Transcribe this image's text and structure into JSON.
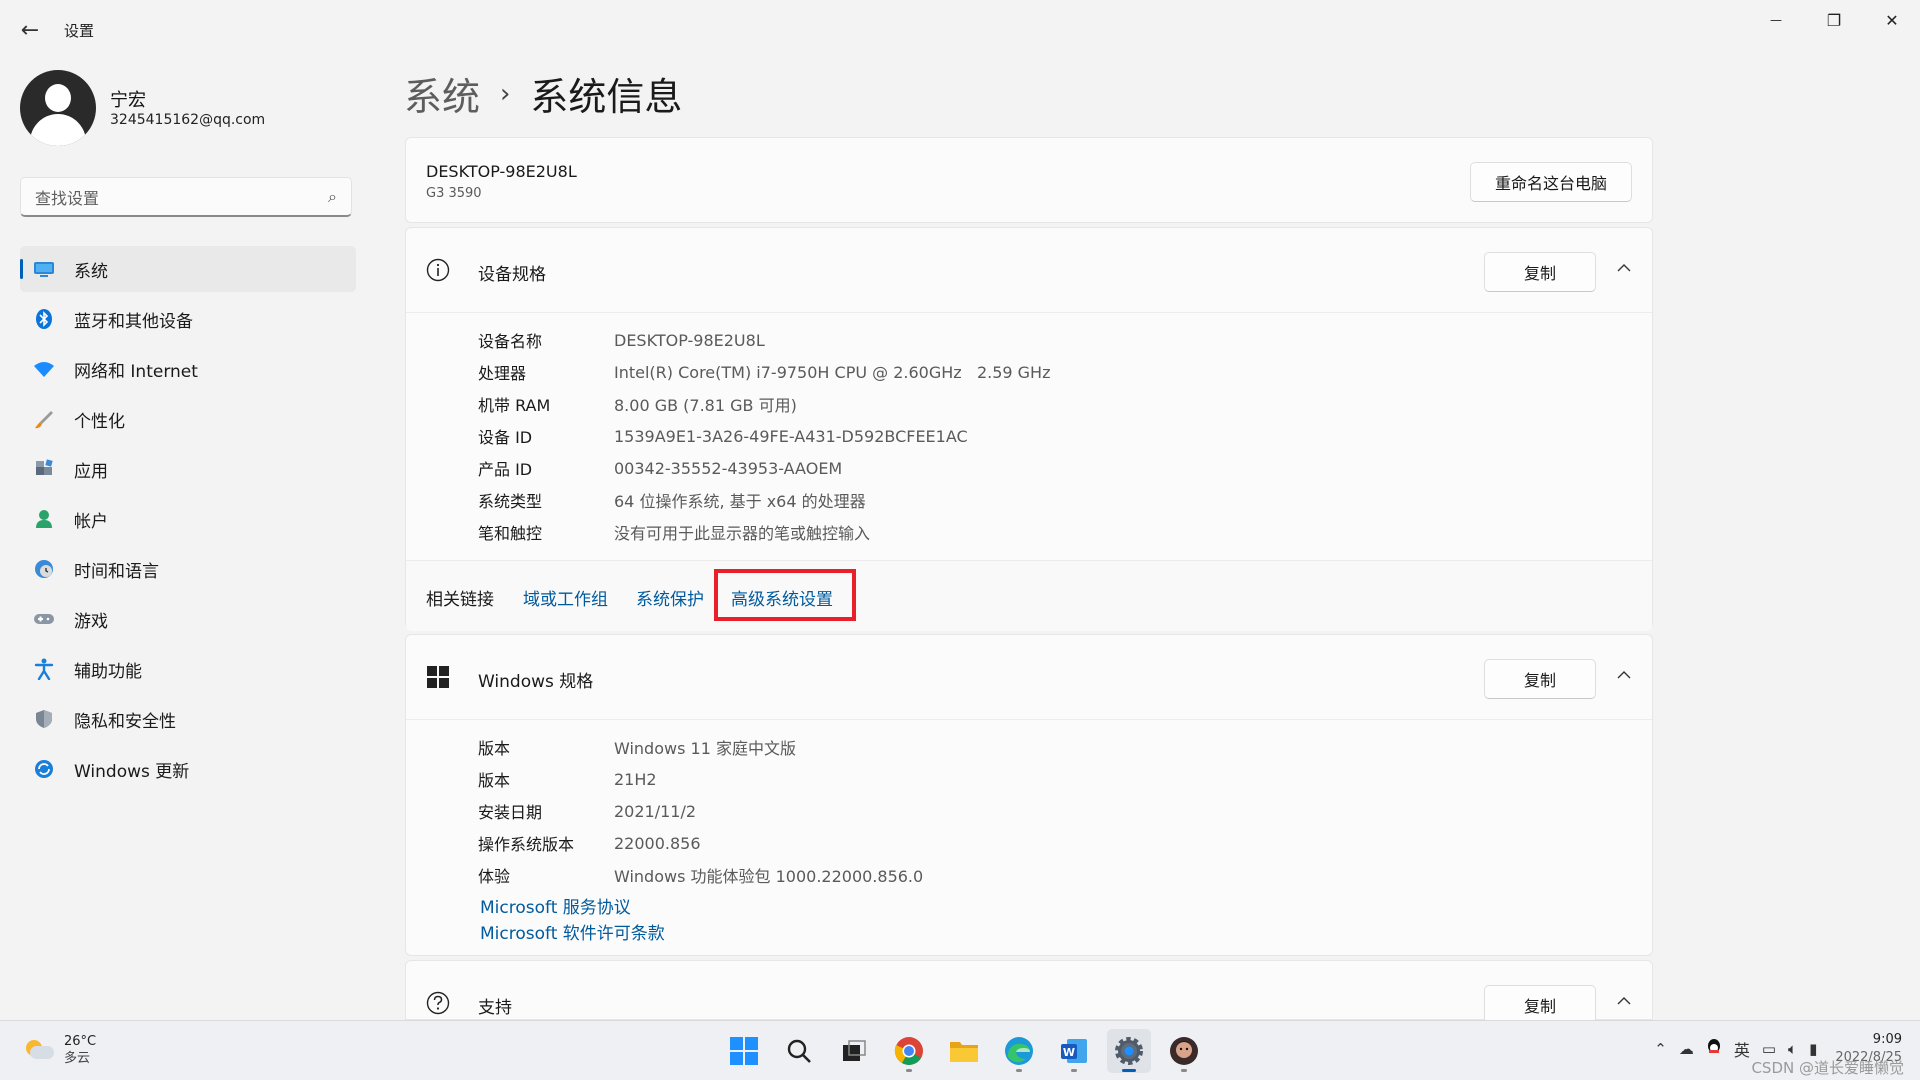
{
  "window": {
    "title": "设置",
    "back_icon": "←",
    "minimize_icon": "—",
    "maximize_icon": "❐",
    "close_icon": "✕"
  },
  "profile": {
    "name": "宁宏",
    "email": "3245415162@qq.com"
  },
  "search": {
    "placeholder": "查找设置",
    "icon": "⌕"
  },
  "nav": {
    "items": [
      {
        "label": "系统",
        "icon": "monitor-icon"
      },
      {
        "label": "蓝牙和其他设备",
        "icon": "bluetooth-icon"
      },
      {
        "label": "网络和 Internet",
        "icon": "wifi-icon"
      },
      {
        "label": "个性化",
        "icon": "brush-icon"
      },
      {
        "label": "应用",
        "icon": "apps-icon"
      },
      {
        "label": "帐户",
        "icon": "person-icon"
      },
      {
        "label": "时间和语言",
        "icon": "globe-clock-icon"
      },
      {
        "label": "游戏",
        "icon": "gamepad-icon"
      },
      {
        "label": "辅助功能",
        "icon": "accessibility-icon"
      },
      {
        "label": "隐私和安全性",
        "icon": "shield-icon"
      },
      {
        "label": "Windows 更新",
        "icon": "update-icon"
      }
    ],
    "active_index": 0
  },
  "breadcrumb": {
    "parent": "系统",
    "separator": "›",
    "current": "系统信息"
  },
  "device": {
    "name": "DESKTOP-98E2U8L",
    "model": "G3 3590",
    "rename_button": "重命名这台电脑"
  },
  "device_specs": {
    "title": "设备规格",
    "copy_button": "复制",
    "rows": [
      {
        "label": "设备名称",
        "value": "DESKTOP-98E2U8L"
      },
      {
        "label": "处理器",
        "value": "Intel(R) Core(TM) i7-9750H CPU @ 2.60GHz   2.59 GHz"
      },
      {
        "label": "机带 RAM",
        "value": "8.00 GB (7.81 GB 可用)"
      },
      {
        "label": "设备 ID",
        "value": "1539A9E1-3A26-49FE-A431-D592BCFEE1AC"
      },
      {
        "label": "产品 ID",
        "value": "00342-35552-43953-AAOEM"
      },
      {
        "label": "系统类型",
        "value": "64 位操作系统, 基于 x64 的处理器"
      },
      {
        "label": "笔和触控",
        "value": "没有可用于此显示器的笔或触控输入"
      }
    ],
    "related": {
      "label": "相关链接",
      "links": [
        "域或工作组",
        "系统保护",
        "高级系统设置"
      ]
    }
  },
  "windows_specs": {
    "title": "Windows 规格",
    "copy_button": "复制",
    "rows": [
      {
        "label": "版本",
        "value": "Windows 11 家庭中文版"
      },
      {
        "label": "版本",
        "value": "21H2"
      },
      {
        "label": "安装日期",
        "value": "2021/11/2"
      },
      {
        "label": "操作系统版本",
        "value": "22000.856"
      },
      {
        "label": "体验",
        "value": "Windows 功能体验包 1000.22000.856.0"
      }
    ],
    "links": [
      "Microsoft 服务协议",
      "Microsoft 软件许可条款"
    ]
  },
  "support": {
    "title": "支持",
    "copy_button": "复制"
  },
  "taskbar": {
    "weather_temp": "26°C",
    "weather_desc": "多云",
    "apps": [
      "start-icon",
      "search-icon",
      "task-view-icon",
      "chrome-icon",
      "file-explorer-icon",
      "edge-icon",
      "word-icon",
      "settings-icon",
      "avatar-app-icon"
    ],
    "ime": "英",
    "time": "9:09",
    "date": "2022/8/25",
    "watermark": "CSDN @道长爱睡懒觉"
  },
  "colors": {
    "accent": "#005fb8",
    "link": "#005a9e",
    "highlight": "#e8202a"
  }
}
